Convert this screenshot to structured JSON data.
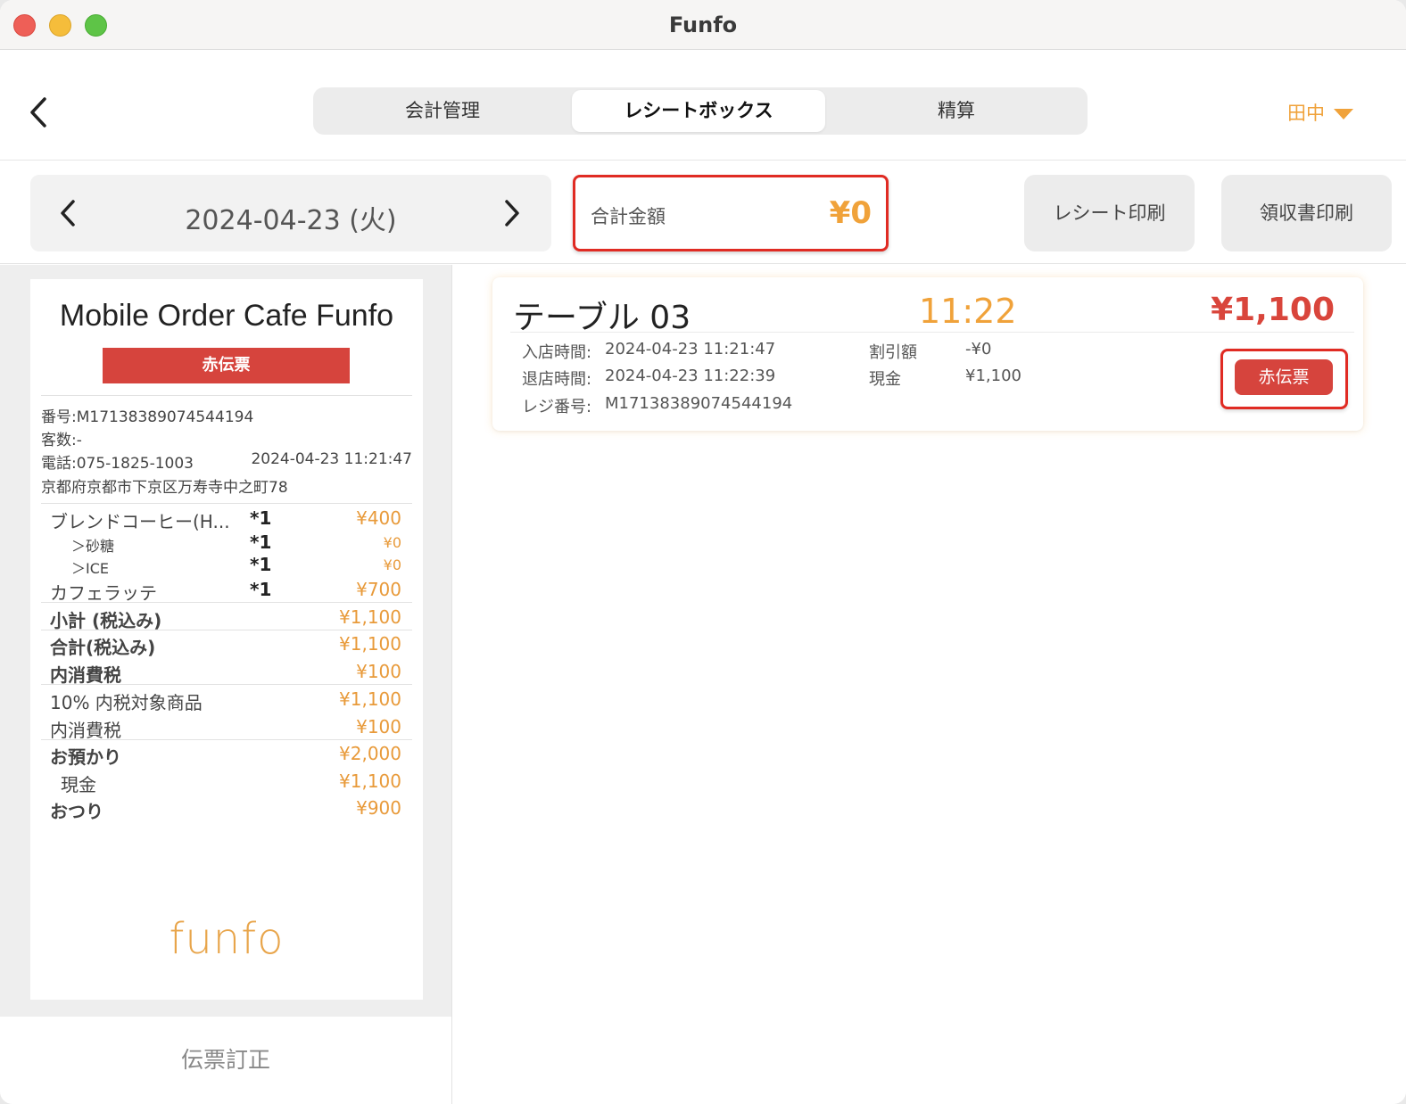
{
  "window": {
    "title": "Funfo"
  },
  "header": {
    "tabs": [
      {
        "label": "会計管理"
      },
      {
        "label": "レシートボックス"
      },
      {
        "label": "精算"
      }
    ],
    "user": "田中"
  },
  "toolbar": {
    "date": "2024-04-23 (火)",
    "total_label": "合計金額",
    "total_value": "¥0",
    "print_receipt": "レシート印刷",
    "print_ryoshu": "領収書印刷"
  },
  "receipt": {
    "store_name": "Mobile Order Cafe Funfo",
    "badge": "赤伝票",
    "number": "番号:M17138389074544194",
    "guests": "客数:-",
    "phone": "電話:075-1825-1003",
    "datetime": "2024-04-23 11:21:47",
    "address": "京都府京都市下京区万寿寺中之町78",
    "items": [
      {
        "name": "ブレンドコーヒー(H...",
        "qty": "*1",
        "price": "¥400"
      },
      {
        "name": "＞砂糖",
        "qty": "*1",
        "price": "¥0"
      },
      {
        "name": "＞ICE",
        "qty": "*1",
        "price": "¥0"
      },
      {
        "name": "カフェラッテ",
        "qty": "*1",
        "price": "¥700"
      }
    ],
    "summary": [
      {
        "label": "小計 (税込み)",
        "value": "¥1,100"
      },
      {
        "label": "合計(税込み)",
        "value": "¥1,100"
      },
      {
        "label": "内消費税",
        "value": "¥100"
      },
      {
        "label": "10% 内税対象商品",
        "value": "¥1,100"
      },
      {
        "label": "内消費税",
        "value": "¥100"
      },
      {
        "label": "お預かり",
        "value": "¥2,000"
      },
      {
        "label": "現金",
        "value": "¥1,100"
      },
      {
        "label": "おつり",
        "value": "¥900"
      }
    ],
    "logo": "funfo",
    "correction": "伝票訂正"
  },
  "orders": [
    {
      "table": "テーブル 03",
      "time": "11:22",
      "amount": "¥1,100",
      "checkin_label": "入店時間:",
      "checkin": "2024-04-23 11:21:47",
      "checkout_label": "退店時間:",
      "checkout": "2024-04-23 11:22:39",
      "register_label": "レジ番号:",
      "register": "M17138389074544194",
      "discount_label": "割引額",
      "discount": "-¥0",
      "cash_label": "現金",
      "cash": "¥1,100",
      "red_slip": "赤伝票"
    }
  ],
  "colors": {
    "accent": "#f0a23a",
    "red": "#d6443d",
    "highlight": "#e02b23"
  }
}
